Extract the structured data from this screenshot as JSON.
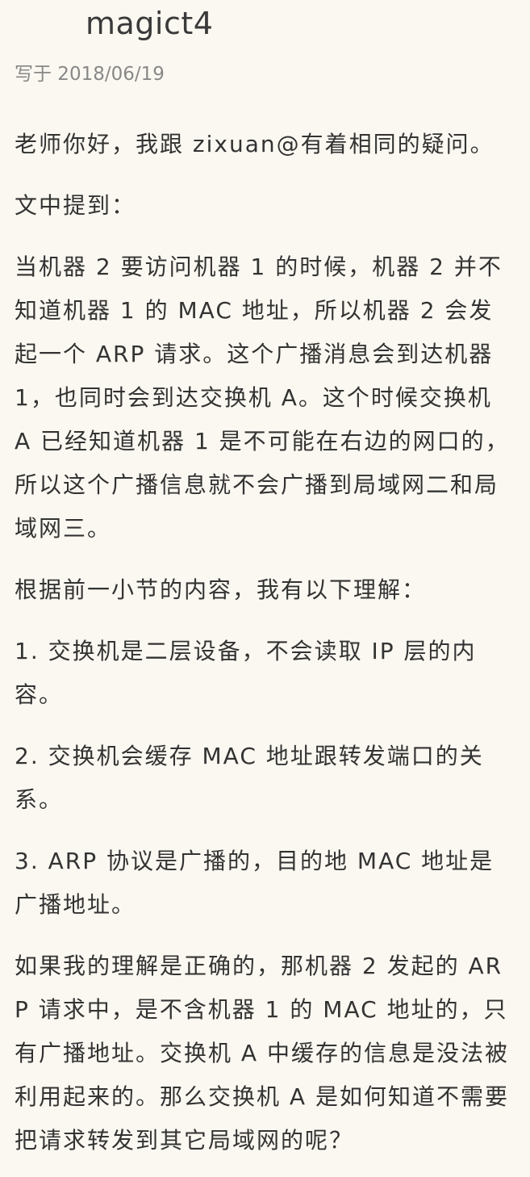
{
  "comment": {
    "username": "magict4",
    "date_label": "写于 2018/06/19"
  },
  "content": {
    "paragraphs": [
      "老师你好，我跟 zixuan@有着相同的疑问。",
      "文中提到：",
      "当机器 2 要访问机器 1 的时候，机器 2 并不知道机器 1 的 MAC 地址，所以机器 2 会发起一个 ARP 请求。这个广播消息会到达机器 1，也同时会到达交换机 A。这个时候交换机 A 已经知道机器 1 是不可能在右边的网口的，所以这个广播信息就不会广播到局域网二和局域网三。",
      "根据前一小节的内容，我有以下理解：",
      "1. 交换机是二层设备，不会读取 IP 层的内容。",
      "2. 交换机会缓存 MAC 地址跟转发端口的关系。",
      "3. ARP 协议是广播的，目的地 MAC 地址是广播地址。",
      "如果我的理解是正确的，那机器 2 发起的 ARP 请求中，是不含机器 1 的 MAC 地址的，只有广播地址。交换机 A 中缓存的信息是没法被利用起来的。那么交换机 A 是如何知道不需要把请求转发到其它局域网的呢？"
    ]
  }
}
